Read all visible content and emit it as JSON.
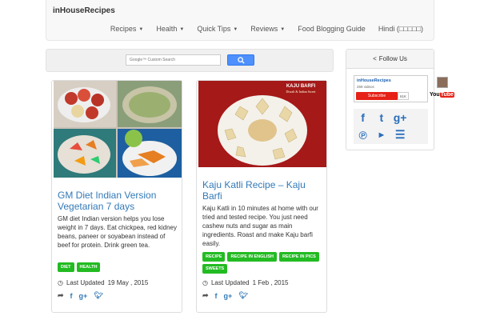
{
  "header": {
    "brand": "inHouseRecipes",
    "nav": [
      {
        "label": "Recipes",
        "dropdown": true
      },
      {
        "label": "Health",
        "dropdown": true
      },
      {
        "label": "Quick Tips",
        "dropdown": true
      },
      {
        "label": "Reviews",
        "dropdown": true
      },
      {
        "label": "Food Blogging Guide",
        "dropdown": false
      },
      {
        "label": "Hindi (□□□□□)",
        "dropdown": false
      }
    ]
  },
  "search": {
    "placeholder": "Google™ Custom Search",
    "button_icon": "search-icon"
  },
  "posts": [
    {
      "title": "GM Diet Indian Version Vegetarian 7 days",
      "excerpt": "GM diet Indian version helps you lose weight in 7 days. Eat chickpea, red kidney beans, paneer or soyabean instead of beef for protein. Drink green tea.",
      "tags": [
        "DIET",
        "HEALTH"
      ],
      "updated_label": "Last Updated",
      "updated_date": "19 May , 2015"
    },
    {
      "title": "Kaju Katli Recipe – Kaju Barfi",
      "excerpt": "Kaju Katli in 10 minutes at home with our tried and tested recipe. You just need cashew nuts and sugar as main ingredients. Roast and make Kaju barfi easily.",
      "tags": [
        "RECIPE",
        "RECIPE IN ENGLISH",
        "RECIPE IN PICS",
        "SWEETS"
      ],
      "updated_label": "Last Updated",
      "updated_date": "1 Feb , 2015",
      "image_caption": "KAJU BARFI",
      "image_subcaption": "Diwali & Indian Sweet"
    }
  ],
  "follow": {
    "title": "Follow Us",
    "youtube": {
      "channel": "inHouseRecipes",
      "videos": "259 videos",
      "subscribe": "Subscribe",
      "count": "61K",
      "logo_you": "You",
      "logo_tube": "Tube"
    },
    "icons": [
      "facebook-icon",
      "twitter-icon",
      "google-plus-icon",
      "pinterest-icon",
      "youtube-icon",
      "rss-icon"
    ]
  },
  "colors": {
    "link": "#337ab7",
    "tag": "#22bb22",
    "youtube": "#e62117",
    "search_button": "#4d90fe"
  }
}
